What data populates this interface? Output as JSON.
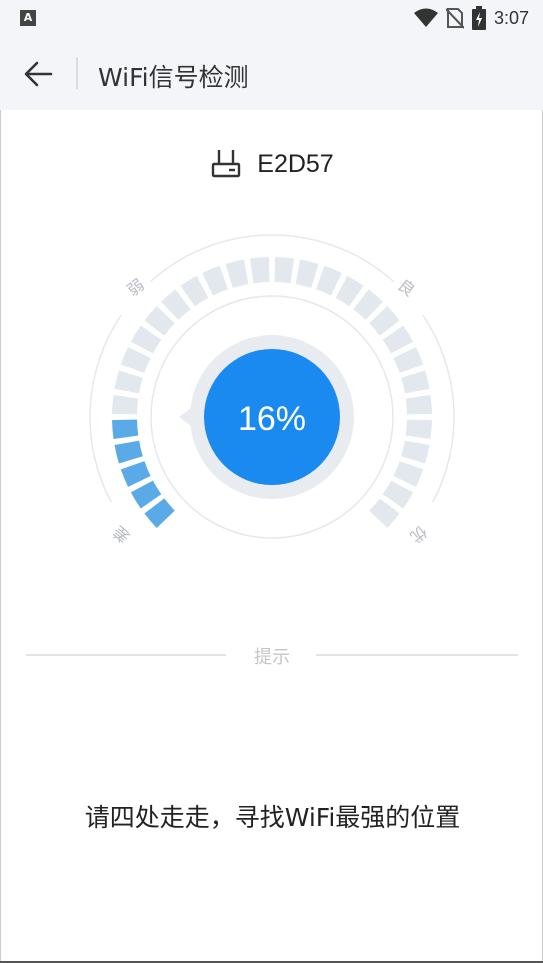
{
  "status_bar": {
    "left_icon": "A",
    "icons": [
      "wifi-icon",
      "no-sim-icon",
      "battery-charging-icon"
    ],
    "time": "3:07"
  },
  "header": {
    "back_icon": "arrow-left-icon",
    "title": "WiFi信号检测"
  },
  "router": {
    "icon": "router-icon",
    "name": "E2D57"
  },
  "gauge": {
    "percent_text": "16%",
    "signal_fraction": 0.16,
    "active_segments": 5,
    "total_segments": 30,
    "labels": {
      "weak": "弱",
      "good": "良",
      "poor": "差",
      "excellent": "优"
    },
    "colors": {
      "active": "#5aaae8",
      "inactive": "#e3e8ef",
      "center": "#1a8af0"
    }
  },
  "tip": {
    "label": "提示",
    "text": "请四处走走，寻找WiFi最强的位置"
  }
}
